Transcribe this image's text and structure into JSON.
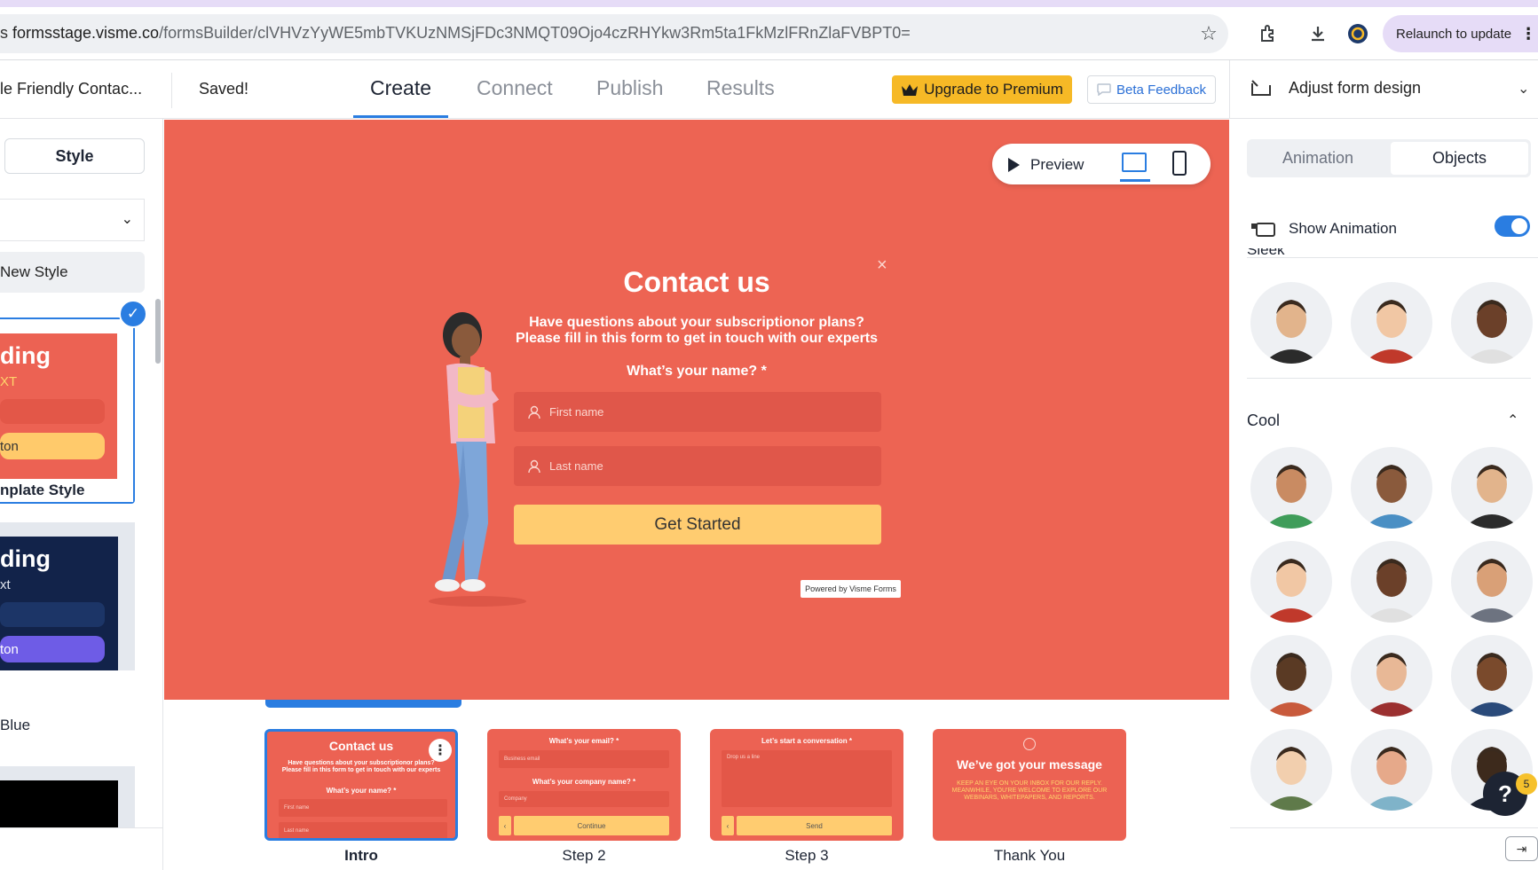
{
  "browser": {
    "url_host": "formsstage.visme.co",
    "url_path": "/formsBuilder/clVHVzYyWE5mbTVKUzNMSjFDc3NMQT09Ojo4czRHYkw3Rm5ta1FkMzlFRnZlaFVBPT0=",
    "url_prefix": "s",
    "relaunch_label": "Relaunch to update"
  },
  "header": {
    "form_name": "le Friendly Contac...",
    "saved": "Saved!",
    "tabs": [
      "Create",
      "Connect",
      "Publish",
      "Results"
    ],
    "active_tab": "Create",
    "upgrade_label": "Upgrade to Premium",
    "beta_label": "Beta Feedback",
    "adjust_label": "Adjust form design"
  },
  "left_panel": {
    "style_tab": "Style",
    "new_style": "New Style",
    "templates": [
      {
        "heading": "ding",
        "sub": "XT",
        "button": "ton",
        "label": "nplate Style"
      },
      {
        "heading": "ding",
        "sub": "xt",
        "button": "ton",
        "label": "Blue"
      }
    ]
  },
  "canvas": {
    "preview_label": "Preview",
    "form": {
      "title": "Contact us",
      "description": "Have questions about your subscriptionor plans? Please fill in this form to get in touch with our experts",
      "name_label": "What’s your name? *",
      "first_name_placeholder": "First name",
      "last_name_placeholder": "Last name",
      "submit_label": "Get Started",
      "powered_by": "Powered by Visme Forms",
      "close_glyph": "×"
    },
    "colors": {
      "background": "#ed6453",
      "field": "#e0574a",
      "button": "#ffcc70",
      "accent": "#2a7de1"
    }
  },
  "steps": [
    {
      "label": "Intro",
      "selected": true,
      "title": "Contact us",
      "desc": "Have questions about your subscriptionor plans? Please fill in this form to get in touch with our experts",
      "q": "What’s your name? *",
      "f1": "First name",
      "f2": "Last name"
    },
    {
      "label": "Step 2",
      "selected": false,
      "q1": "What’s your email? *",
      "f1": "Business email",
      "q2": "What’s your company name? *",
      "f2": "Company",
      "btn": "Continue"
    },
    {
      "label": "Step 3",
      "selected": false,
      "q1": "Let’s start a conversation *",
      "f1": "Drop us a line",
      "btn": "Send"
    },
    {
      "label": "Thank You",
      "selected": false,
      "title": "We’ve got your message",
      "desc": "KEEP AN EYE ON YOUR INBOX FOR OUR REPLY. MEANWHILE, YOU’RE WELCOME TO EXPLORE OUR WEBINARS, WHITEPAPERS, AND REPORTS."
    }
  ],
  "right_panel": {
    "tab_animation": "Animation",
    "tab_objects": "Objects",
    "show_animation": "Show Animation",
    "show_animation_on": true,
    "section_sleek": "Sleek",
    "section_cool": "Cool",
    "sleek_avatars": [
      "avatar-green-shirt",
      "avatar-blue-shirt",
      "avatar-bearded-vest"
    ],
    "cool_avatars": [
      "avatar-sunglasses",
      "avatar-braids",
      "avatar-blond-beard",
      "avatar-woman-bob",
      "avatar-dreadlocks",
      "avatar-waving",
      "avatar-suit",
      "avatar-bun",
      "avatar-shades-green",
      "avatar-glasses-blonde",
      "avatar-ginger",
      "avatar-afro"
    ],
    "help_glyph": "?",
    "help_badge": "5"
  }
}
